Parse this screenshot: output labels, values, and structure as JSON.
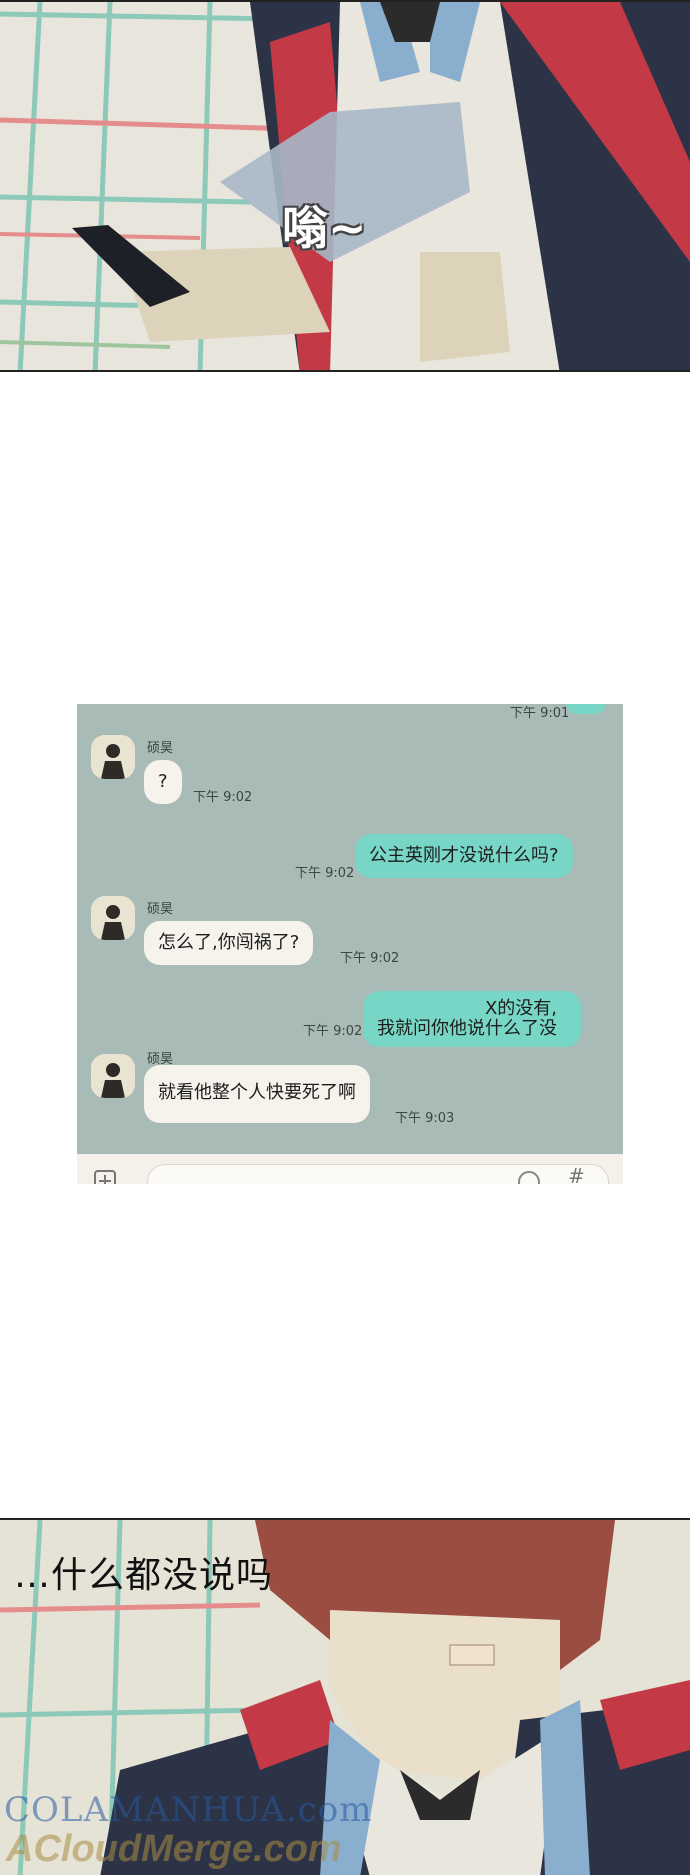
{
  "top_panel": {
    "sfx": "嗡~"
  },
  "chat": {
    "messages": [
      {
        "dir": "in",
        "sender": "硕昊",
        "text": "?",
        "time": "下午 9:02"
      },
      {
        "dir": "out",
        "text": "公主英刚才没说什么吗?",
        "time": "下午 9:02"
      },
      {
        "dir": "in",
        "sender": "硕昊",
        "text": "怎么了,你闯祸了?",
        "time": "下午 9:02"
      },
      {
        "dir": "out",
        "text": "X的没有,\n我就问你他说什么了没",
        "time": "下午 9:02"
      },
      {
        "dir": "in",
        "sender": "硕昊",
        "text": "就看他整个人快要死了啊",
        "time": "下午 9:03"
      }
    ],
    "partial_top_time": "下午 9:01",
    "input_bar": {
      "add_icon": "plus-icon",
      "emoji_icon": "emoji-icon",
      "hash_icon": "hash-icon",
      "hash_glyph": "#"
    }
  },
  "bottom_panel": {
    "caption": "…什么都没说吗"
  },
  "watermark": {
    "line1": "COLAMANHUA.com",
    "line2": "ACloudMerge.com"
  },
  "colors": {
    "chat_bg": "#a9bbb6",
    "bubble_in": "#f5f3ec",
    "bubble_out": "#78d6c6"
  }
}
